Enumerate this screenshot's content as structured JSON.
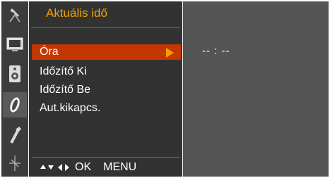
{
  "sidebar": {
    "items": [
      {
        "icon": "antenna-icon"
      },
      {
        "icon": "screen-icon"
      },
      {
        "icon": "speaker-icon"
      },
      {
        "icon": "clock-icon"
      },
      {
        "icon": "wrench-icon"
      },
      {
        "icon": "cross-icon"
      }
    ]
  },
  "menu": {
    "title": "Aktuális idő",
    "items": [
      {
        "label": "Óra",
        "selected": true
      },
      {
        "label": "Időzítő Ki",
        "selected": false
      },
      {
        "label": "Időzítő Be",
        "selected": false
      },
      {
        "label": "Aut.kikapcs.",
        "selected": false
      }
    ],
    "footer": {
      "ok": "OK",
      "menu": "MENU"
    }
  },
  "content": {
    "time_value": "-- : --"
  },
  "colors": {
    "accent": "#f0a000",
    "selection": "#c43700",
    "panel": "#323232"
  }
}
